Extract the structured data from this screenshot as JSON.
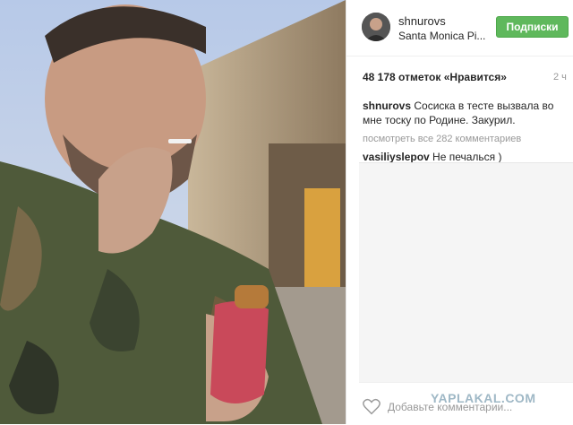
{
  "post": {
    "username": "shnurovs",
    "location": "Santa Monica Pi...",
    "follow_label": "Подписки",
    "likes": "48 178 отметок «Нравится»",
    "time": "2 ч",
    "caption_author": "shnurovs",
    "caption_text": " Сосиска в тесте вызвала во мне тоску по Родине. Закурил.",
    "view_all": "посмотреть все 282 комментариев",
    "comment_author": "vasiliyslepov",
    "comment_text": " Не печалься )",
    "add_comment_placeholder": "Добавьте комментарии...",
    "watermark": "YAPLAKAL.COM"
  },
  "colors": {
    "follow_bg": "#5fb85c",
    "text": "#262626",
    "muted": "#999999"
  }
}
